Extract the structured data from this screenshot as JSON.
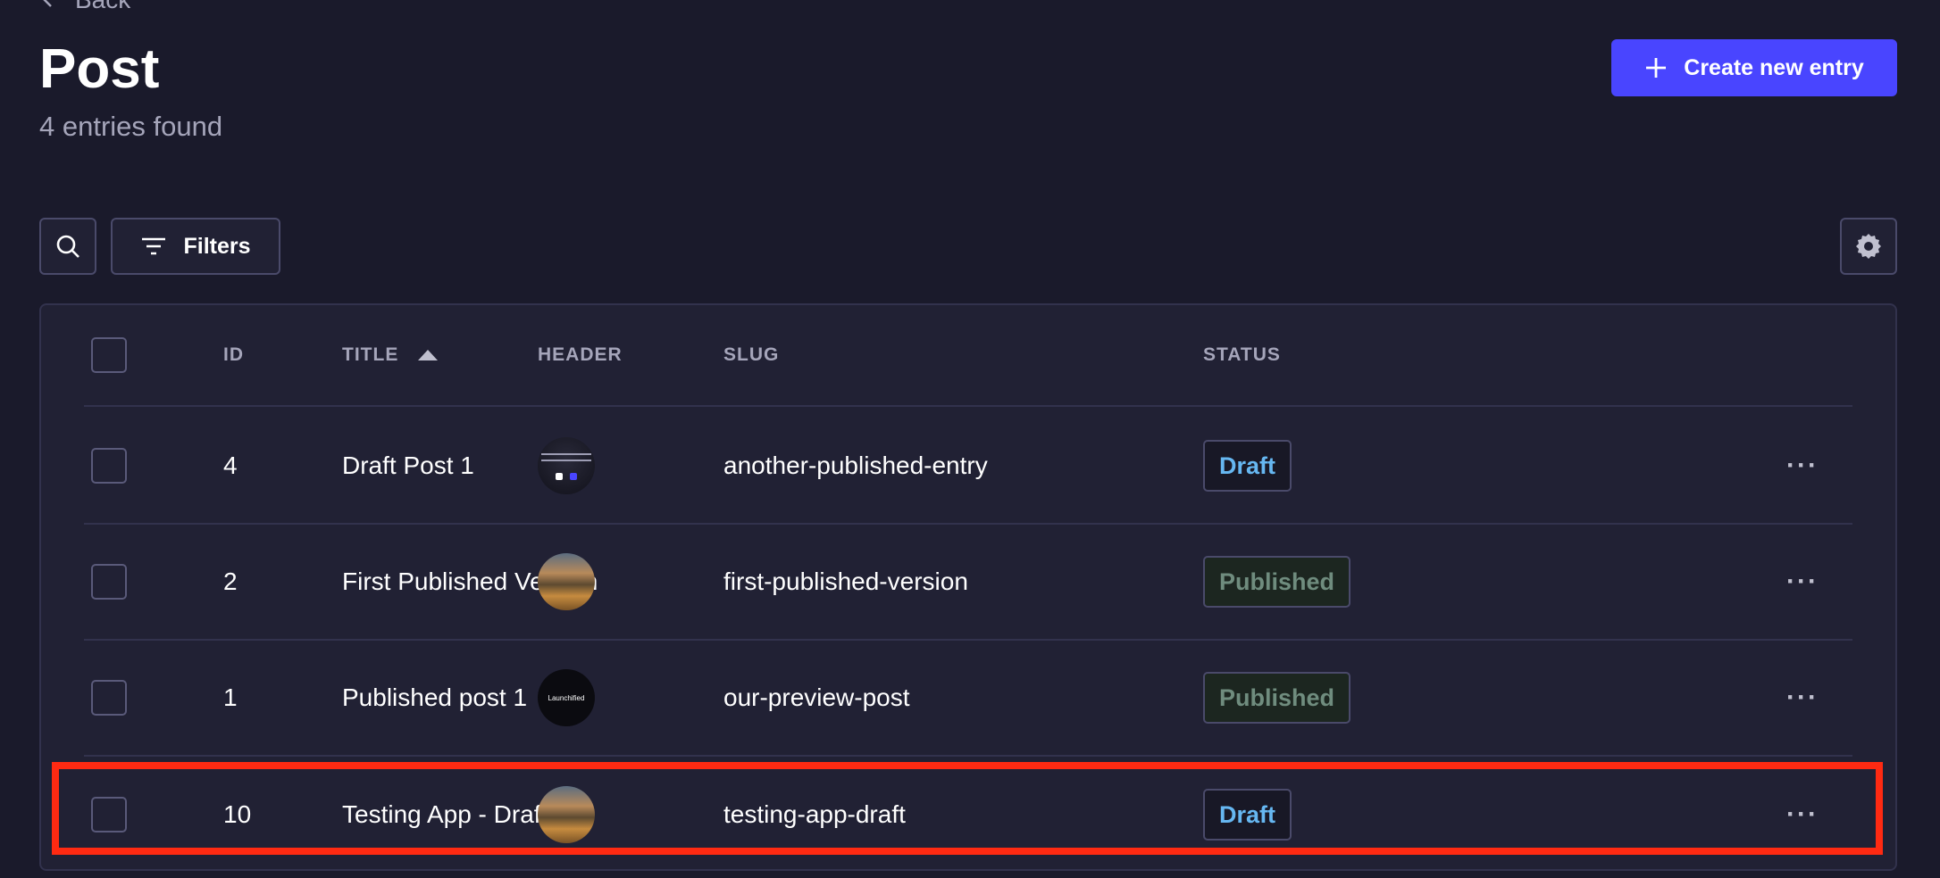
{
  "nav": {
    "back_label": "Back"
  },
  "header": {
    "title": "Post",
    "subtitle": "4 entries found",
    "create_label": "Create new entry"
  },
  "toolbar": {
    "filters_label": "Filters"
  },
  "table": {
    "columns": {
      "id": "ID",
      "title": "TITLE",
      "header": "HEADER",
      "slug": "SLUG",
      "status": "STATUS"
    },
    "sort": {
      "column": "title",
      "direction": "ascending"
    },
    "rows": [
      {
        "id": "4",
        "title": "Draft Post 1",
        "header_image": "dark-slide-thumbnail",
        "slug": "another-published-entry",
        "status": "Draft"
      },
      {
        "id": "2",
        "title": "First Published Version",
        "header_image": "landscape-thumbnail",
        "slug": "first-published-version",
        "status": "Published"
      },
      {
        "id": "1",
        "title": "Published post 1",
        "header_image": "launchified-logo-thumbnail",
        "slug": "our-preview-post",
        "status": "Published"
      },
      {
        "id": "10",
        "title": "Testing App - Draft",
        "header_image": "landscape-thumbnail",
        "slug": "testing-app-draft",
        "status": "Draft"
      }
    ],
    "more_label": "···",
    "launchified_text": "Launchified"
  },
  "highlighted_row": 3,
  "colors": {
    "background": "#1a1a2b",
    "card": "#212134",
    "accent": "#4945ff",
    "draft_text": "#66b7f1",
    "published_text": "#6f8c7e",
    "highlight": "#ff2a12"
  },
  "icons": {
    "back": "chevron-left-icon",
    "create": "plus-icon",
    "search": "search-icon",
    "filters": "filter-icon",
    "settings": "gear-icon",
    "sort": "sort-ascending-icon",
    "more": "more-horizontal-icon"
  }
}
